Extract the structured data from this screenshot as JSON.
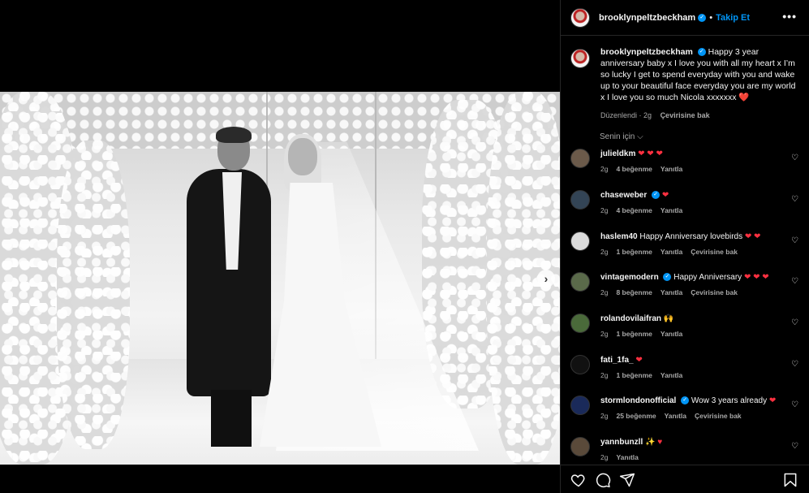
{
  "post": {
    "username": "brooklynpeltzbeckham",
    "follow_label": "Takip Et",
    "more_label": "•••",
    "caption": "Happy 3 year anniversary baby x I love you with all my heart x I’m so lucky I get to spend everyday with you and wake up to your beautiful face everyday you are my world x I love you so much Nicola xxxxxxx",
    "caption_heart": "❤️",
    "edited": "Düzenlendi · 2g",
    "translate": "Çevirisine bak",
    "for_you": "Senin için ⌵"
  },
  "carousel_next": "›",
  "comments": [
    {
      "user": "julieldkm",
      "text": "",
      "emoji": "❤ ❤ ❤",
      "time": "2g",
      "likes": "4 beğenme",
      "reply": "Yanıtla",
      "translate": "",
      "avatar": "#6b5a4a"
    },
    {
      "user": "chaseweber",
      "verified": "✓",
      "text": "",
      "emoji": "❤",
      "time": "2g",
      "likes": "4 beğenme",
      "reply": "Yanıtla",
      "translate": "",
      "avatar": "#334455"
    },
    {
      "user": "haslem40",
      "text": "Happy Anniversary lovebirds",
      "emoji": "❤ ❤",
      "time": "2g",
      "likes": "1 beğenme",
      "reply": "Yanıtla",
      "translate": "Çevirisine bak",
      "avatar": "#dbdbdb"
    },
    {
      "user": "vintagemodern",
      "verified": "✓",
      "text": "Happy Anniversary",
      "emoji": "❤ ❤ ❤",
      "time": "2g",
      "likes": "8 beğenme",
      "reply": "Yanıtla",
      "translate": "Çevirisine bak",
      "avatar": "#5a6a4a"
    },
    {
      "user": "rolandovilaifran",
      "text": "",
      "emoji": "🙌",
      "time": "2g",
      "likes": "1 beğenme",
      "reply": "Yanıtla",
      "translate": "",
      "avatar": "#4a6a3a"
    },
    {
      "user": "fati_1fa_",
      "text": "",
      "emoji": "❤",
      "time": "2g",
      "likes": "1 beğenme",
      "reply": "Yanıtla",
      "translate": "",
      "avatar": "#111111"
    },
    {
      "user": "stormlondonofficial",
      "verified": "✓",
      "text": "Wow 3 years already",
      "emoji": "❤",
      "time": "2g",
      "likes": "25 beğenme",
      "reply": "Yanıtla",
      "translate": "Çevirisine bak",
      "avatar": "#1a2a5a"
    },
    {
      "user": "yannbunzll",
      "text": "",
      "emoji": "✨ ♥",
      "time": "2g",
      "likes": "",
      "reply": "Yanıtla",
      "translate": "",
      "avatar": "#5a4a3a"
    }
  ],
  "colors": {
    "accent": "#0095f6",
    "like_red": "#ff3040",
    "panel_bg": "#000000",
    "muted": "#a8a8a8"
  },
  "icons": [
    "heart-icon",
    "comment-icon",
    "share-icon",
    "bookmark-icon",
    "more-icon",
    "verified-icon",
    "chevron-right-icon"
  ]
}
